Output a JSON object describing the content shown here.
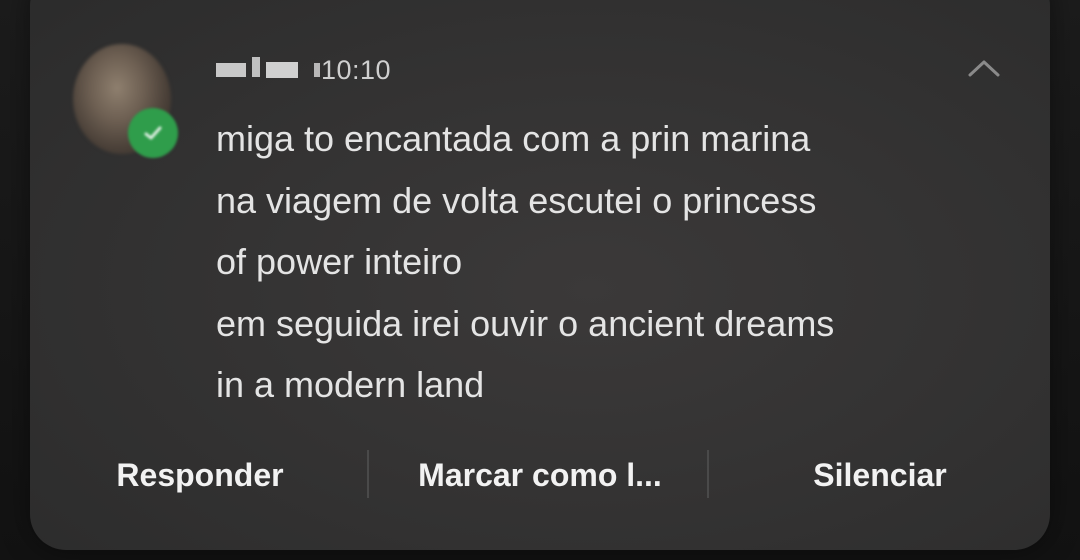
{
  "notification": {
    "time": "10:10",
    "message_lines": [
      "miga to encantada com a prin marina",
      "na viagem de volta escutei o princess",
      "of power inteiro",
      "em seguida irei ouvir o ancient dreams",
      "in a modern land"
    ],
    "actions": {
      "reply": "Responder",
      "mark_read": "Marcar como l...",
      "mute": "Silenciar"
    }
  },
  "icons": {
    "collapse": "chevron-up-icon",
    "app_badge": "whatsapp-badge-icon"
  },
  "colors": {
    "card_background": "#363535",
    "badge_green": "#2f9d4b",
    "text_primary": "#e4e4e4",
    "action_text": "#f2f2f2"
  }
}
